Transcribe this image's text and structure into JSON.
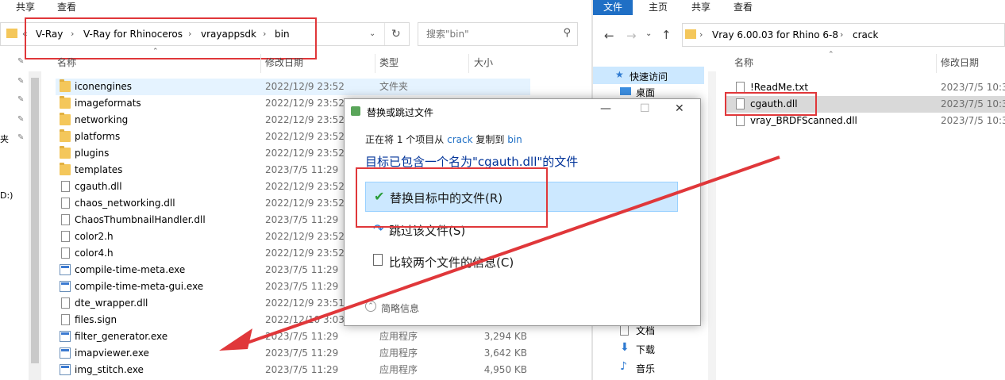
{
  "left": {
    "ribbon": {
      "share": "共享",
      "view": "查看"
    },
    "address": {
      "overflow": "«",
      "crumbs": [
        "V-Ray",
        "V-Ray for Rhinoceros",
        "vrayappsdk",
        "bin"
      ]
    },
    "search": {
      "placeholder": "搜索\"bin\""
    },
    "columns": {
      "name": "名称",
      "date": "修改日期",
      "type": "类型",
      "size": "大小"
    },
    "sidebar_fragments": [
      "夹",
      "D:)"
    ],
    "files": [
      {
        "name": "iconengines",
        "date": "2022/12/9 23:52",
        "type": "文件夹",
        "size": "",
        "kind": "folder"
      },
      {
        "name": "imageformats",
        "date": "2022/12/9 23:52",
        "type": "",
        "size": "",
        "kind": "folder"
      },
      {
        "name": "networking",
        "date": "2022/12/9 23:52",
        "type": "",
        "size": "",
        "kind": "folder"
      },
      {
        "name": "platforms",
        "date": "2022/12/9 23:52",
        "type": "",
        "size": "",
        "kind": "folder"
      },
      {
        "name": "plugins",
        "date": "2022/12/9 23:52",
        "type": "",
        "size": "",
        "kind": "folder"
      },
      {
        "name": "templates",
        "date": "2023/7/5 11:29",
        "type": "",
        "size": "",
        "kind": "folder"
      },
      {
        "name": "cgauth.dll",
        "date": "2022/12/9 23:52",
        "type": "",
        "size": "",
        "kind": "file"
      },
      {
        "name": "chaos_networking.dll",
        "date": "2022/12/9 23:52",
        "type": "",
        "size": "",
        "kind": "file"
      },
      {
        "name": "ChaosThumbnailHandler.dll",
        "date": "2023/7/5 11:29",
        "type": "",
        "size": "",
        "kind": "file"
      },
      {
        "name": "color2.h",
        "date": "2022/12/9 23:52",
        "type": "",
        "size": "",
        "kind": "file"
      },
      {
        "name": "color4.h",
        "date": "2022/12/9 23:52",
        "type": "",
        "size": "",
        "kind": "file"
      },
      {
        "name": "compile-time-meta.exe",
        "date": "2023/7/5 11:29",
        "type": "",
        "size": "",
        "kind": "exe"
      },
      {
        "name": "compile-time-meta-gui.exe",
        "date": "2023/7/5 11:29",
        "type": "",
        "size": "",
        "kind": "exe"
      },
      {
        "name": "dte_wrapper.dll",
        "date": "2022/12/9 23:51",
        "type": "",
        "size": "",
        "kind": "file"
      },
      {
        "name": "files.sign",
        "date": "2022/12/10 3:03",
        "type": "",
        "size": "",
        "kind": "file"
      },
      {
        "name": "filter_generator.exe",
        "date": "2023/7/5 11:29",
        "type": "应用程序",
        "size": "3,294 KB",
        "kind": "exe"
      },
      {
        "name": "imapviewer.exe",
        "date": "2023/7/5 11:29",
        "type": "应用程序",
        "size": "3,642 KB",
        "kind": "exe"
      },
      {
        "name": "img_stitch.exe",
        "date": "2023/7/5 11:29",
        "type": "应用程序",
        "size": "4,950 KB",
        "kind": "exe"
      }
    ]
  },
  "right": {
    "ribbon": {
      "file": "文件",
      "home": "主页",
      "share": "共享",
      "view": "查看"
    },
    "address": {
      "crumbs": [
        "Vray 6.00.03 for Rhino 6-8",
        "crack"
      ]
    },
    "columns": {
      "name": "名称",
      "date": "修改日期"
    },
    "nav": {
      "quick_access": "快速访问",
      "desktop": "桌面",
      "documents": "文档",
      "downloads": "下载",
      "music": "音乐"
    },
    "files": [
      {
        "name": "!ReadMe.txt",
        "date": "2023/7/5 10:3"
      },
      {
        "name": "cgauth.dll",
        "date": "2023/7/5 10:3"
      },
      {
        "name": "vray_BRDFScanned.dll",
        "date": "2023/7/5 10:3"
      }
    ]
  },
  "dialog": {
    "title": "替换或跳过文件",
    "subtitle_prefix": "正在将 1 个项目从",
    "from": "crack",
    "middle": "复制到",
    "to": "bin",
    "heading": "目标已包含一个名为\"cgauth.dll\"的文件",
    "options": {
      "replace": "替换目标中的文件(R)",
      "skip": "跳过该文件(S)",
      "compare": "比较两个文件的信息(C)"
    },
    "details": "简略信息",
    "minimize": "—",
    "maximize": "☐",
    "close": "✕"
  },
  "colors": {
    "annotation_red": "#e0373a",
    "accent_blue": "#1f6fc5",
    "selection": "#cce8ff"
  }
}
